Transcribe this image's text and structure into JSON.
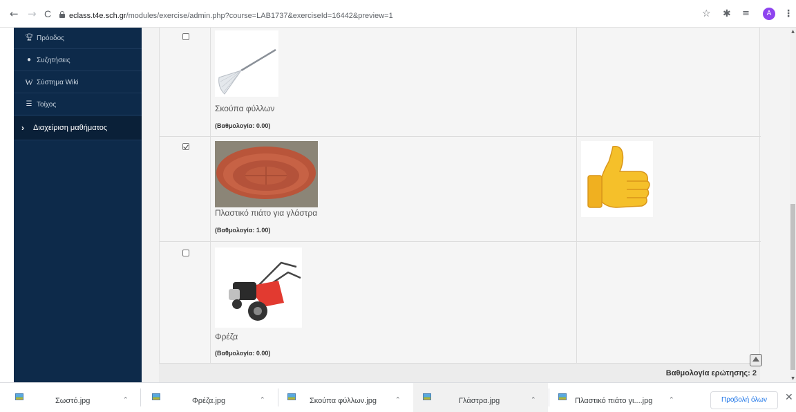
{
  "browser": {
    "back": "←",
    "forward": "→",
    "reload": "C",
    "url_host": "eclass.t4e.sch.gr",
    "url_path": "/modules/exercise/admin.php?course=LAB1737&exerciseId=16442&preview=1",
    "avatar_letter": "A",
    "icons": [
      "star-icon",
      "extensions-icon",
      "media-icon",
      "menu-icon"
    ]
  },
  "sidebar": {
    "items": [
      {
        "icon": "trophy-icon",
        "label": "Πρόοδος"
      },
      {
        "icon": "chat-icon",
        "label": "Συζητήσεις"
      },
      {
        "icon": "wiki-icon",
        "label": "Σύστημα Wiki"
      },
      {
        "icon": "list-icon",
        "label": "Τοίχος"
      }
    ],
    "manage_label": "Διαχείριση μαθήματος"
  },
  "answers": [
    {
      "label": "Σκούπα φύλλων",
      "score": "(Βαθμολογία: 0.00)",
      "checked": false,
      "image": "leaf-rake-image"
    },
    {
      "label": "Πλαστικό πιάτο για γλάστρα",
      "score": "(Βαθμολογία: 1.00)",
      "checked": true,
      "image": "plastic-saucer-image",
      "feedback": "thumbs-up-image"
    },
    {
      "label": "Φρέζα",
      "score": "(Βαθμολογία: 0.00)",
      "checked": false,
      "image": "rototiller-image"
    }
  ],
  "question_score": "Βαθμολογία ερώτησης: 2",
  "downloads": {
    "items": [
      "Σωστό.jpg",
      "Φρέζα.jpg",
      "Σκούπα φύλλων.jpg",
      "Γλάστρα.jpg",
      "Πλαστικό πιάτο γι....jpg"
    ],
    "show_all": "Προβολή όλων",
    "close": "✕"
  },
  "colors": {
    "sidebar_bg": "#0d2a4a",
    "accent_blue": "#1a73e8",
    "avatar": "#8e44ef"
  }
}
